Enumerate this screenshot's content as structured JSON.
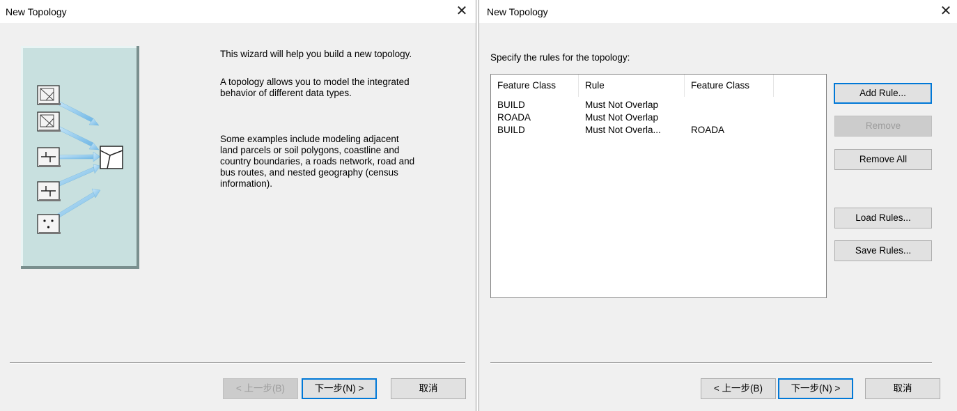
{
  "dialog1": {
    "title": "New Topology",
    "close_glyph": "✕",
    "paragraphs": [
      "This wizard will help you build a new topology.",
      "A topology allows you to model the integrated behavior of different data types.",
      "Some examples include modeling adjacent land parcels or soil polygons, coastline and country boundaries, a roads network, road and bus routes, and nested geography (census information)."
    ],
    "buttons": {
      "back": "< 上一步(B)",
      "next": "下一步(N) >",
      "cancel": "取消"
    }
  },
  "dialog2": {
    "title": "New Topology",
    "close_glyph": "✕",
    "rules_label": "Specify the rules for the topology:",
    "columns": [
      "Feature Class",
      "Rule",
      "Feature Class"
    ],
    "rows": [
      {
        "feature_class_1": "BUILD",
        "rule": "Must Not Overlap",
        "feature_class_2": ""
      },
      {
        "feature_class_1": "ROADA",
        "rule": "Must Not Overlap",
        "feature_class_2": ""
      },
      {
        "feature_class_1": "BUILD",
        "rule": "Must Not Overla...",
        "feature_class_2": "ROADA"
      }
    ],
    "side_buttons": {
      "add_rule": "Add Rule...",
      "remove": "Remove",
      "remove_all": "Remove All",
      "load_rules": "Load Rules...",
      "save_rules": "Save Rules..."
    },
    "buttons": {
      "back": "< 上一步(B)",
      "next": "下一步(N) >",
      "cancel": "取消"
    }
  },
  "colors": {
    "dialog_bg": "#f0f0f0",
    "accent_focus": "#0078d7",
    "illustration_bg": "#c8e0df",
    "arrow": "#8ec8ec"
  },
  "icons": [
    "polygon-feature-icon",
    "line-feature-icon",
    "point-feature-icon",
    "topology-icon",
    "arrow-icon"
  ]
}
